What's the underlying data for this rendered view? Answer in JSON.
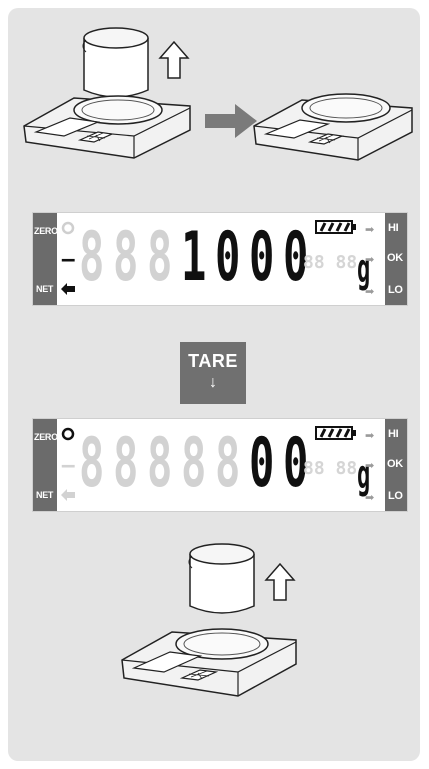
{
  "display_top": {
    "digits": [
      "8",
      "8",
      "8",
      "1",
      "0",
      "0",
      "0"
    ],
    "active": [
      false,
      false,
      false,
      true,
      true,
      true,
      true
    ],
    "label_zero": "ZERO",
    "label_net": "NET",
    "label_hi": "HI",
    "label_ok": "OK",
    "label_lo": "LO",
    "sign": "–",
    "unit": "g",
    "zero_indicator_on": false
  },
  "tare_button": {
    "label": "TARE",
    "arrow": "↓"
  },
  "display_bottom": {
    "digits": [
      "8",
      "8",
      "8",
      "8",
      "8",
      "0",
      "0"
    ],
    "active": [
      false,
      false,
      false,
      false,
      false,
      true,
      true
    ],
    "label_zero": "ZERO",
    "label_net": "NET",
    "label_hi": "HI",
    "label_ok": "OK",
    "label_lo": "LO",
    "unit": "g",
    "zero_indicator_on": true
  },
  "colors": {
    "panel": "#e4e4e4",
    "button": "#707070",
    "ghost_segment": "#d2d2d2",
    "active_segment": "#101010"
  }
}
